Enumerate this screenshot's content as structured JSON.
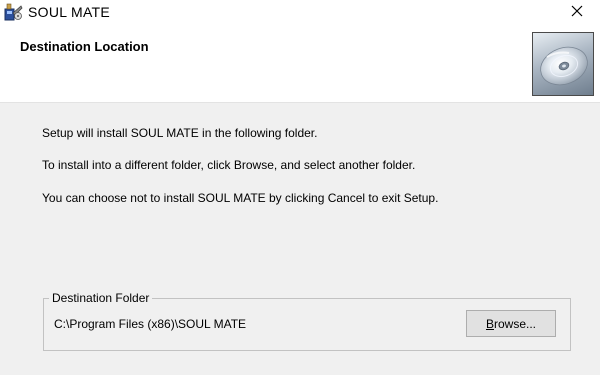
{
  "window": {
    "title": "SOUL MATE",
    "close_icon": "close-icon",
    "app_icon": "installer-app-icon"
  },
  "header": {
    "title": "Destination Location",
    "image_icon": "cd-disc-icon"
  },
  "body": {
    "line1": "Setup will install SOUL MATE in the following folder.",
    "line2": "To install into a different folder, click Browse, and select another folder.",
    "line3": "You can choose not to install SOUL MATE by clicking Cancel to exit Setup."
  },
  "destination": {
    "group_label": "Destination Folder",
    "path": "C:\\Program Files (x86)\\SOUL MATE",
    "browse_mnemonic": "B",
    "browse_rest": "rowse..."
  },
  "colors": {
    "background": "#f0f0f0",
    "header_background": "#ffffff",
    "button_face": "#e1e1e1",
    "button_border": "#adadad"
  }
}
